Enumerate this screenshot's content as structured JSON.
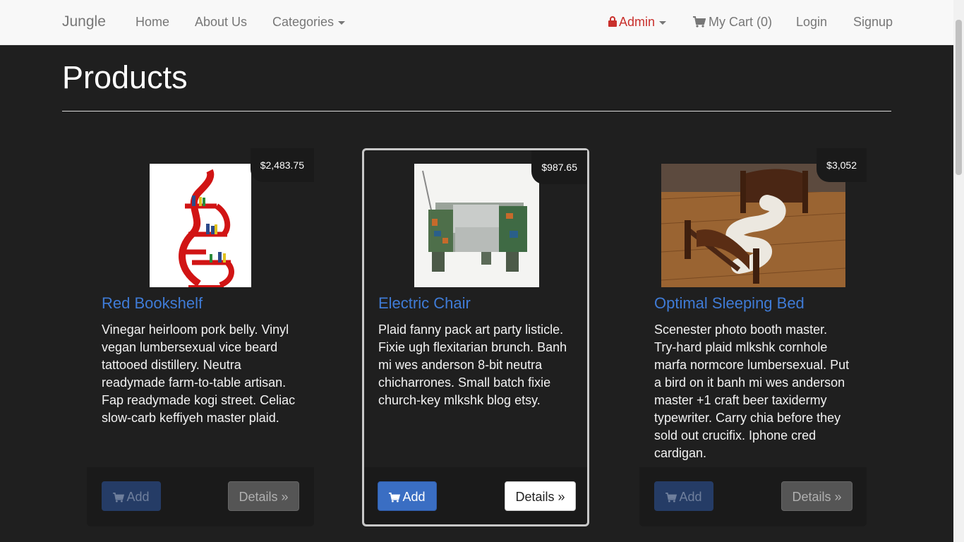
{
  "navbar": {
    "brand": "Jungle",
    "links": {
      "home": "Home",
      "about": "About Us",
      "categories": "Categories"
    },
    "right": {
      "admin": "Admin",
      "cart": "My Cart (0)",
      "login": "Login",
      "signup": "Signup"
    }
  },
  "page": {
    "title": "Products"
  },
  "products": [
    {
      "name": "Red Bookshelf",
      "price": "$2,483.75",
      "description": "Vinegar heirloom pork belly. Vinyl vegan lumbersexual vice beard tattooed distillery. Neutra readymade farm-to-table artisan. Fap readymade kogi street. Celiac slow-carb keffiyeh master plaid.",
      "add_label": "Add",
      "details_label": "Details »"
    },
    {
      "name": "Electric Chair",
      "price": "$987.65",
      "description": "Plaid fanny pack art party listicle. Fixie ugh flexitarian brunch. Banh mi wes anderson 8-bit neutra chicharrones. Small batch fixie church-key mlkshk blog etsy.",
      "add_label": "Add",
      "details_label": "Details »"
    },
    {
      "name": "Optimal Sleeping Bed",
      "price": "$3,052",
      "description": "Scenester photo booth master. Try-hard plaid mlkshk cornhole marfa normcore lumbersexual. Put a bird on it banh mi wes anderson master +1 craft beer taxidermy typewriter. Carry chia before they sold out crucifix. Iphone cred cardigan.",
      "add_label": "Add",
      "details_label": "Details »"
    }
  ],
  "colors": {
    "background": "#1f1f1f",
    "navbar": "#f8f8f8",
    "link": "#3f7bd6",
    "admin": "#c9302c",
    "primary_button": "#3a6ec3"
  }
}
